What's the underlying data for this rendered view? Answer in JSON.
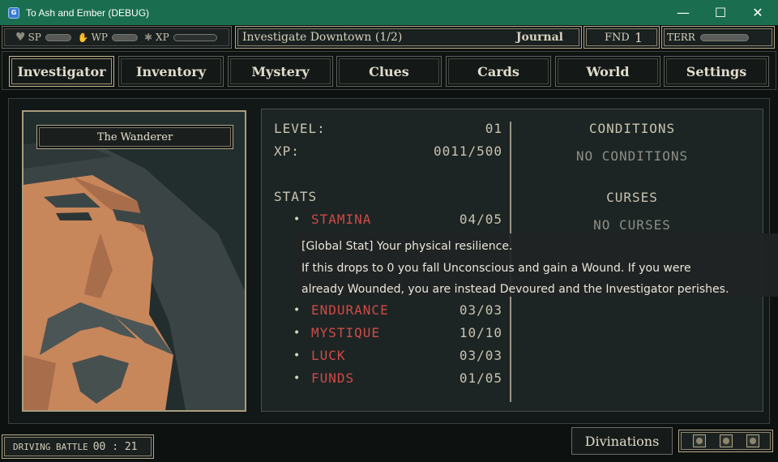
{
  "window": {
    "title": "To Ash and Ember (DEBUG)",
    "minimize": "—",
    "maximize": "☐",
    "close": "✕"
  },
  "status": {
    "sp_label": "SP",
    "wp_label": "WP",
    "xp_label": "XP",
    "quest": "Investigate Downtown (1/2)",
    "journal": "Journal",
    "fnd_label": "FND",
    "fnd_value": "1",
    "terr_label": "TERR"
  },
  "tabs": [
    "Investigator",
    "Inventory",
    "Mystery",
    "Clues",
    "Cards",
    "World",
    "Settings"
  ],
  "active_tab": "Investigator",
  "investigator": {
    "name": "The Wanderer"
  },
  "level": {
    "label": "LEVEL:",
    "value": "01"
  },
  "xp": {
    "label": "XP:",
    "value": "0011/500"
  },
  "stats": {
    "title": "STATS",
    "items": [
      {
        "name": "STAMINA",
        "value": "04/05"
      },
      {
        "name": "ENDURANCE",
        "value": "03/03"
      },
      {
        "name": "MYSTIQUE",
        "value": "10/10"
      },
      {
        "name": "LUCK",
        "value": "03/03"
      },
      {
        "name": "FUNDS",
        "value": "01/05"
      }
    ]
  },
  "conditions": {
    "title": "CONDITIONS",
    "empty": "NO CONDITIONS"
  },
  "curses": {
    "title": "CURSES",
    "empty": "NO CURSES"
  },
  "tooltip": {
    "line1": "[Global Stat] Your physical resilience.",
    "line2": "If this drops to 0 you fall Unconscious and gain a Wound. If you were",
    "line3": "already Wounded, you are instead Devoured and the Investigator perishes."
  },
  "timer": {
    "label": "DRIVING BATTLE",
    "value": "00 : 21"
  },
  "divinations": "Divinations",
  "colors": {
    "titlebar": "#1a6e4f",
    "skin": "#c8865b",
    "hat": "#3a4444",
    "accent_red": "#d14a46"
  }
}
